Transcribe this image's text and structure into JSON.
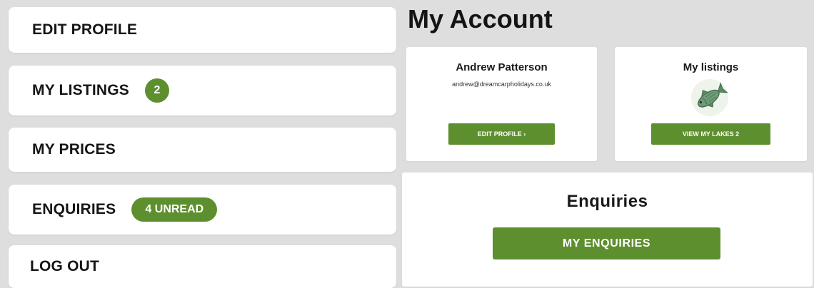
{
  "colors": {
    "accent": "#5e8f2e",
    "background": "#dedede",
    "card": "#ffffff"
  },
  "sidebar": {
    "items": [
      {
        "label": "EDIT PROFILE"
      },
      {
        "label": "MY LISTINGS",
        "badge": "2"
      },
      {
        "label": "MY PRICES"
      },
      {
        "label": "ENQUIRIES",
        "badge": "4 UNREAD"
      },
      {
        "label": "LOG OUT"
      }
    ]
  },
  "main": {
    "title": "My Account",
    "profile_card": {
      "name": "Andrew Patterson",
      "email": "andrew@dreamcarpholidays.co.uk",
      "button": "EDIT PROFILE ›"
    },
    "listings_card": {
      "title": "My listings",
      "icon": "fish-icon",
      "button": "VIEW MY LAKES 2"
    },
    "enquiries_card": {
      "title": "Enquiries",
      "button": "MY ENQUIRIES"
    }
  }
}
